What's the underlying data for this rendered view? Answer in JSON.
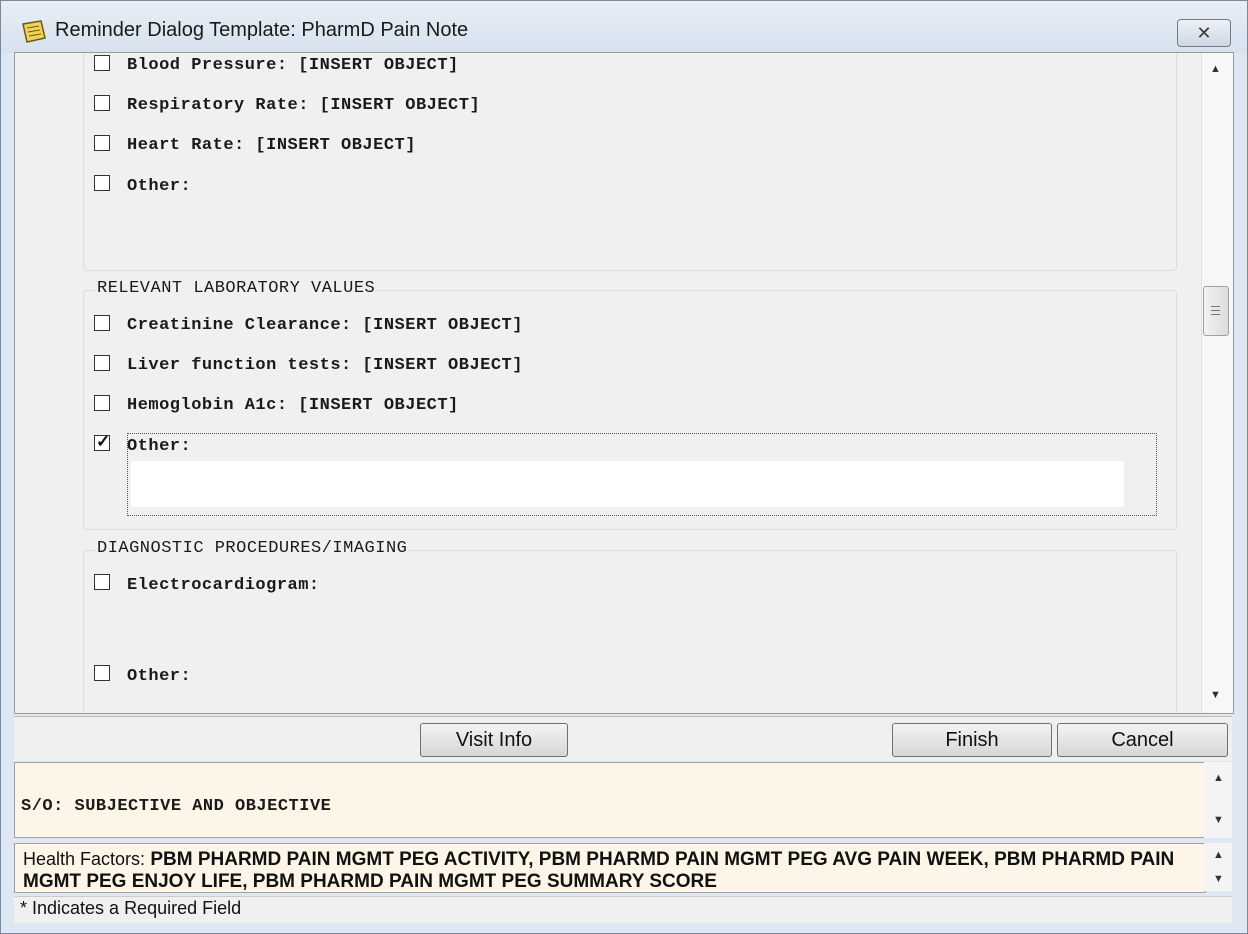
{
  "window": {
    "title": "Reminder Dialog Template: PharmD Pain Note",
    "close_glyph": "✕"
  },
  "vitals_items": [
    {
      "label": "Blood Pressure: [INSERT OBJECT]",
      "checked": false
    },
    {
      "label": "Respiratory Rate: [INSERT OBJECT]",
      "checked": false
    },
    {
      "label": "Heart Rate: [INSERT OBJECT]",
      "checked": false
    },
    {
      "label": "Other:",
      "checked": false
    }
  ],
  "lab_group": {
    "title": "RELEVANT LABORATORY VALUES",
    "items": [
      {
        "label": "Creatinine Clearance: [INSERT OBJECT]",
        "checked": false
      },
      {
        "label": "Liver function tests: [INSERT OBJECT]",
        "checked": false
      },
      {
        "label": "Hemoglobin A1c: [INSERT OBJECT]",
        "checked": false
      },
      {
        "label": "Other:",
        "checked": true,
        "value": ""
      }
    ]
  },
  "diag_group": {
    "title": "DIAGNOSTIC PROCEDURES/IMAGING",
    "items": [
      {
        "label": "Electrocardiogram:",
        "checked": false
      },
      {
        "label": "Other:",
        "checked": false
      }
    ]
  },
  "buttons": {
    "visit_info": "Visit Info",
    "finish": "Finish",
    "cancel": "Cancel"
  },
  "preview": {
    "text": "S/O: SUBJECTIVE AND OBJECTIVE"
  },
  "health_factors": {
    "label": "Health Factors:",
    "text": "PBM PHARMD PAIN MGMT PEG ACTIVITY, PBM PHARMD PAIN MGMT PEG AVG PAIN WEEK, PBM PHARMD PAIN MGMT PEG ENJOY LIFE, PBM PHARMD PAIN MGMT PEG SUMMARY SCORE"
  },
  "status": {
    "text": "* Indicates a Required Field"
  },
  "glyphs": {
    "check": "✓",
    "arrow_up": "▲",
    "arrow_down": "▼"
  }
}
